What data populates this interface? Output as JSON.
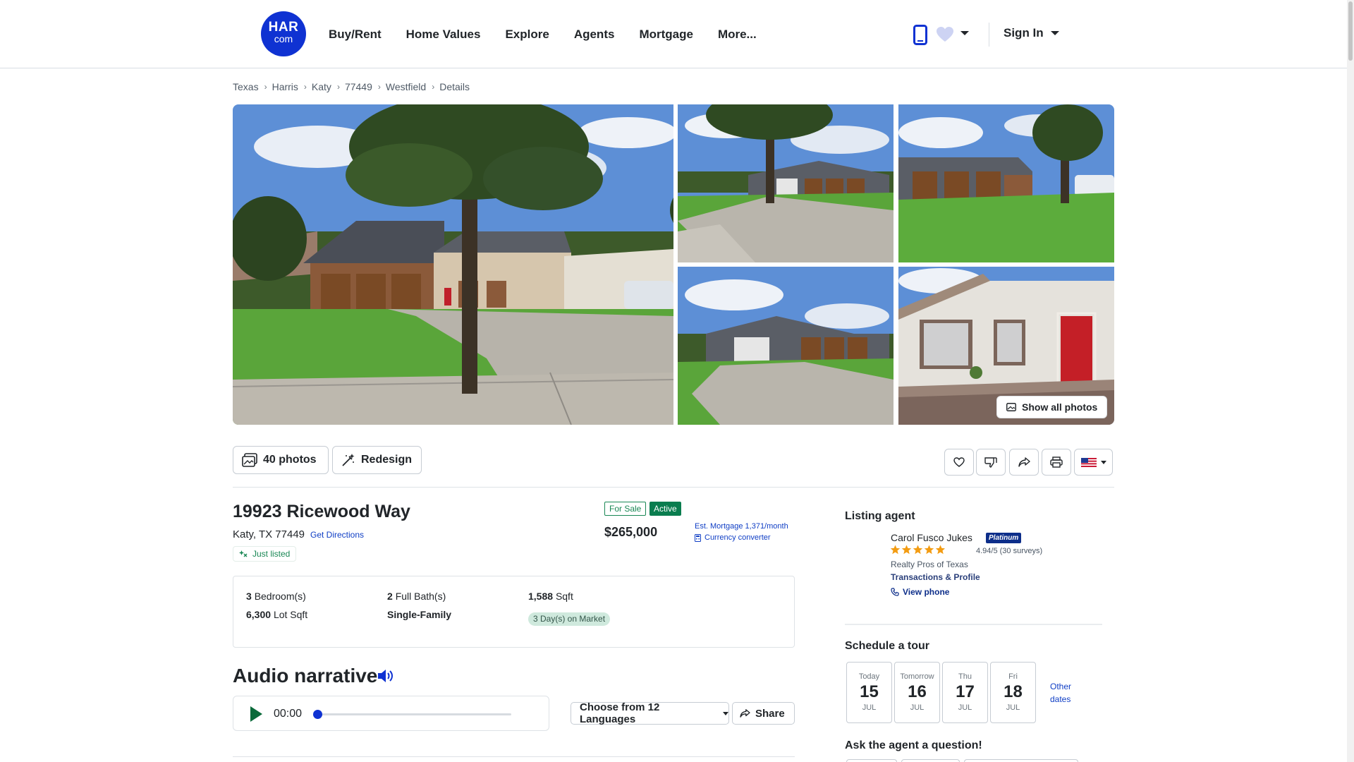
{
  "header": {
    "logo": {
      "line1": "HAR",
      "line2": "com"
    },
    "nav": [
      "Buy/Rent",
      "Home Values",
      "Explore",
      "Agents",
      "Mortgage",
      "More..."
    ],
    "icons": [
      "mobile-phone-icon",
      "heart-badge-icon",
      "caret-down-icon"
    ],
    "signin_label": "Sign In"
  },
  "breadcrumb": [
    "Texas",
    "Harris",
    "Katy",
    "77449",
    "Westfield",
    "Details"
  ],
  "gallery": {
    "show_all_label": "Show all photos"
  },
  "actions": {
    "photos_label": "40 photos",
    "redesign_label": "Redesign",
    "icon_buttons": [
      "heart-icon",
      "thumbs-down-icon",
      "share-icon",
      "print-icon",
      "us-flag-icon"
    ]
  },
  "listing": {
    "address": "19923 Ricewood Way",
    "city_line": "Katy, TX 77449",
    "directions_label": "Get Directions",
    "just_listed": "Just listed",
    "badge_sale": "For Sale",
    "badge_active": "Active",
    "price": "$265,000",
    "est_mortgage": "Est. Mortgage 1,371/month",
    "currency_converter": "Currency converter",
    "facts": {
      "bedrooms_value": "3",
      "bedrooms_label": "Bedroom(s)",
      "baths_value": "2",
      "baths_label": "Full Bath(s)",
      "sqft_value": "1,588",
      "sqft_label": "Sqft",
      "lot_value": "6,300",
      "lot_label": "Lot Sqft",
      "type": "Single-Family",
      "days_on_market": "3 Day(s) on Market"
    }
  },
  "audio": {
    "title": "Audio narrative",
    "time": "00:00",
    "progress": 0,
    "languages_label": "Choose from 12 Languages",
    "share_label": "Share"
  },
  "agent": {
    "section_title": "Listing agent",
    "name": "Carol Fusco Jukes",
    "tier": "Platinum",
    "stars": 4.94,
    "rating_text": "4.94/5 (30 surveys)",
    "brokerage": "Realty Pros of Texas",
    "transactions_label": "Transactions & Profile",
    "view_phone_label": "View phone"
  },
  "tour": {
    "title": "Schedule a tour",
    "days": [
      {
        "weekday": "Today",
        "day": "15",
        "month": "JUL"
      },
      {
        "weekday": "Tomorrow",
        "day": "16",
        "month": "JUL"
      },
      {
        "weekday": "Thu",
        "day": "17",
        "month": "JUL"
      },
      {
        "weekday": "Fri",
        "day": "18",
        "month": "JUL"
      }
    ],
    "other_dates_1": "Other",
    "other_dates_2": "dates"
  },
  "ask": {
    "title": "Ask the agent a question!"
  },
  "colors": {
    "brand_blue": "#0f32d2",
    "active_green": "#0a7d4f",
    "link_blue": "#0f3ec5"
  }
}
